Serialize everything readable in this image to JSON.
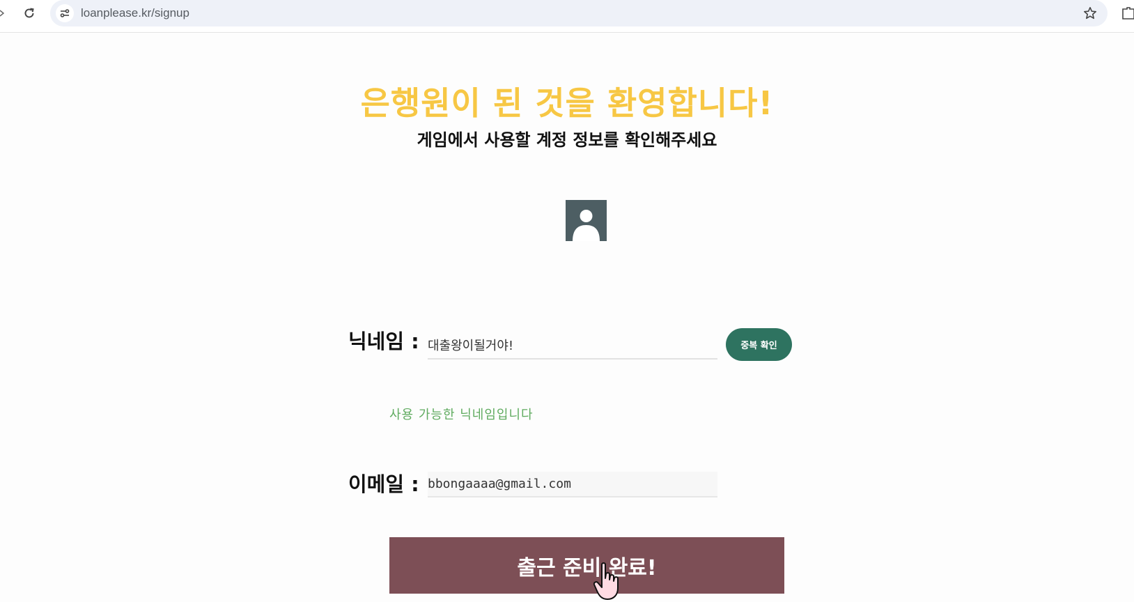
{
  "browser": {
    "url": "loanplease.kr/signup"
  },
  "page": {
    "title": "은행원이 된 것을 환영합니다!",
    "subtitle": "게임에서 사용할 계정 정보를 확인해주세요"
  },
  "form": {
    "nickname_label": "닉네임 :",
    "nickname_value": "대출왕이될거야!",
    "duplicate_check_label": "중복 확인",
    "nickname_status": "사용 가능한 닉네임입니다",
    "email_label": "이메일 :",
    "email_value": "bbongaaaa@gmail.com",
    "submit_label": "출근 준비 완료!"
  },
  "colors": {
    "title": "#f7c744",
    "check_button": "#2e7360",
    "status_ok": "#5fab5f",
    "submit": "#7d4f56",
    "avatar": "#4d5e63"
  },
  "icons": {
    "reload": "reload-icon",
    "site_info": "site-info-icon",
    "bookmark": "star-icon",
    "extensions": "extension-icon",
    "avatar": "user-avatar-icon",
    "cursor": "hand-pointer-icon"
  }
}
